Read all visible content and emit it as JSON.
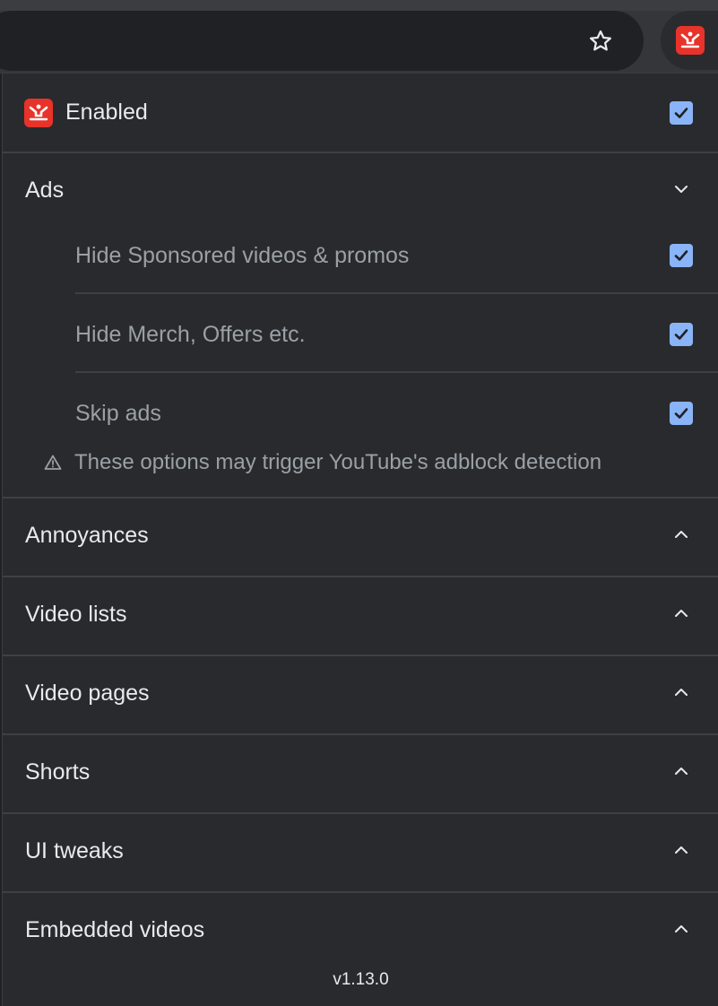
{
  "toolbar": {
    "bookmark_icon": "star-icon",
    "extension_icon": "tweaks-logo-icon"
  },
  "header": {
    "label": "Enabled",
    "checked": true
  },
  "sections": {
    "ads": {
      "title": "Ads",
      "expanded": true,
      "options": [
        {
          "label": "Hide Sponsored videos & promos",
          "checked": true
        },
        {
          "label": "Hide Merch, Offers etc.",
          "checked": true
        },
        {
          "label": "Skip ads",
          "checked": true
        }
      ],
      "warning": "These options may trigger YouTube's adblock detection"
    },
    "annoyances": {
      "title": "Annoyances",
      "expanded": false
    },
    "video_lists": {
      "title": "Video lists",
      "expanded": false
    },
    "video_pages": {
      "title": "Video pages",
      "expanded": false
    },
    "shorts": {
      "title": "Shorts",
      "expanded": false
    },
    "ui_tweaks": {
      "title": "UI tweaks",
      "expanded": false
    },
    "embedded_videos": {
      "title": "Embedded videos",
      "expanded": false
    }
  },
  "footer": {
    "version": "v1.13.0"
  },
  "colors": {
    "accent": "#8ab4f8",
    "brand": "#e8332a",
    "panel": "#292a2d"
  }
}
